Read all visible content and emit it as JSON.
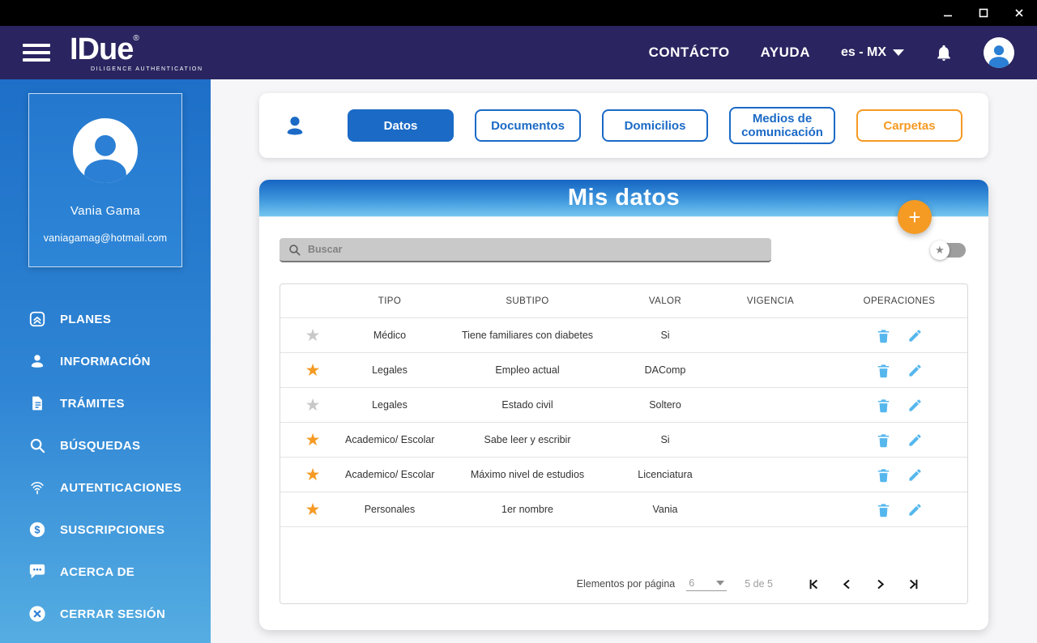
{
  "header": {
    "logo": {
      "title": "IDue",
      "registered": "®",
      "subtitle": "DILIGENCE AUTHENTICATION"
    },
    "nav": {
      "contacto": "CONTÁCTO",
      "ayuda": "AYUDA"
    },
    "language": {
      "value": "es - MX"
    },
    "icons": {
      "menu": "hamburger-menu-icon",
      "bell": "notifications-bell-icon",
      "avatar": "user-avatar-icon"
    }
  },
  "sidebar": {
    "profile": {
      "name": "Vania Gama",
      "email": "vaniagamag@hotmail.com"
    },
    "items": [
      {
        "label": "PLANES",
        "icon": "plans-icon"
      },
      {
        "label": "INFORMACIÓN",
        "icon": "person-icon"
      },
      {
        "label": "TRÁMITES",
        "icon": "document-icon"
      },
      {
        "label": "BÚSQUEDAS",
        "icon": "search-icon"
      },
      {
        "label": "AUTENTICACIONES",
        "icon": "fingerprint-icon"
      },
      {
        "label": "SUSCRIPCIONES",
        "icon": "dollar-icon"
      },
      {
        "label": "ACERCA DE",
        "icon": "chat-icon"
      }
    ],
    "logout": {
      "label": "CERRAR SESIÓN",
      "icon": "logout-icon"
    }
  },
  "tabs": {
    "items": [
      {
        "label": "Datos",
        "state": "active"
      },
      {
        "label": "Documentos",
        "state": "outlined"
      },
      {
        "label": "Domicilios",
        "state": "outlined"
      },
      {
        "label": "Medios de comunicación",
        "state": "outlined"
      },
      {
        "label": "Carpetas",
        "state": "outlined-orange"
      }
    ]
  },
  "datos_card": {
    "title": "Mis datos",
    "add_label": "+",
    "search": {
      "placeholder": "Buscar"
    },
    "favorites_toggle": {
      "icon": "star-filter-toggle",
      "state": "off"
    },
    "table": {
      "headers": [
        "TIPO",
        "SUBTIPO",
        "VALOR",
        "VIGENCIA",
        "OPERACIONES"
      ],
      "rows": [
        {
          "starred": false,
          "tipo": "Médico",
          "subtipo": "Tiene familiares con diabetes",
          "valor": "Si",
          "vigencia": ""
        },
        {
          "starred": true,
          "tipo": "Legales",
          "subtipo": "Empleo actual",
          "valor": "DAComp",
          "vigencia": ""
        },
        {
          "starred": false,
          "tipo": "Legales",
          "subtipo": "Estado civil",
          "valor": "Soltero",
          "vigencia": ""
        },
        {
          "starred": true,
          "tipo": "Academico/ Escolar",
          "subtipo": "Sabe leer y escribir",
          "valor": "Si",
          "vigencia": ""
        },
        {
          "starred": true,
          "tipo": "Academico/ Escolar",
          "subtipo": "Máximo nivel de estudios",
          "valor": "Licenciatura",
          "vigencia": ""
        },
        {
          "starred": true,
          "tipo": "Personales",
          "subtipo": "1er nombre",
          "valor": "Vania",
          "vigencia": ""
        }
      ]
    },
    "pagination": {
      "label": "Elementos por página",
      "page_size": "6",
      "range": "5 de 5"
    }
  },
  "colors": {
    "titlebar": "#000000",
    "header_navy": "#2a2560",
    "sidebar_top": "#1d6fc7",
    "sidebar_bottom": "#55ade2",
    "accent_blue": "#1b6ac6",
    "accent_orange": "#f59a23",
    "operations_icon_blue": "#56b7ed",
    "star_active": "#f59a23",
    "star_inactive": "#c8c8c8",
    "misdatos_gradient_top": "#1565c2",
    "misdatos_gradient_bottom": "#74c6ef"
  }
}
